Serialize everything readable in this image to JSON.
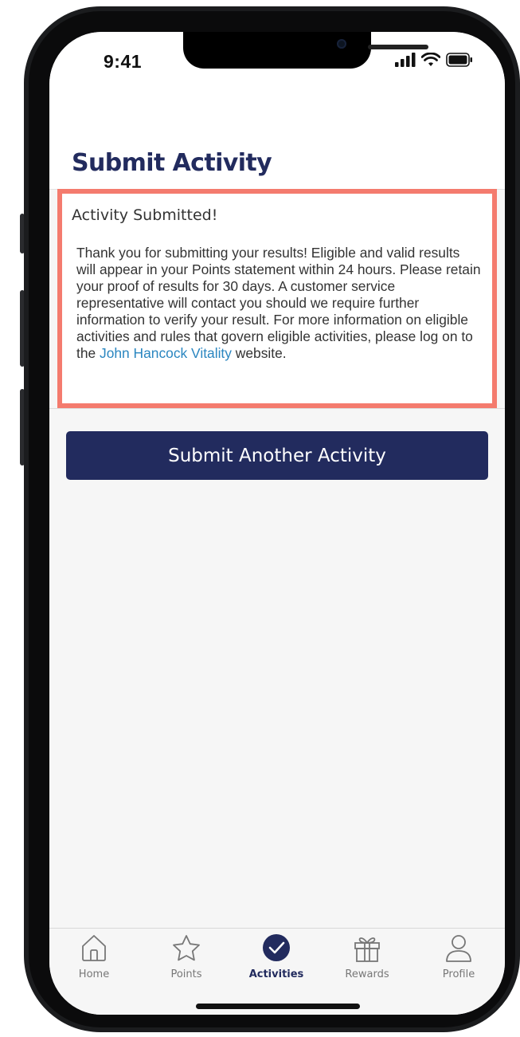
{
  "status_bar": {
    "time": "9:41"
  },
  "header": {
    "title": "Submit Activity"
  },
  "message": {
    "title": "Activity Submitted!",
    "body_before_link": "Thank you for submitting your results! Eligible and valid results will appear in your Points statement within 24 hours. Please retain your proof of results for 30 days. A customer service representative will contact you should we require further information to verify your result. For more information on eligible activities and rules that govern eligible activities, please log on to the ",
    "link_text": "John Hancock Vitality",
    "body_after_link": " website."
  },
  "actions": {
    "submit_another_label": "Submit Another Activity"
  },
  "tab_bar": {
    "active": "Activities",
    "tabs": [
      {
        "label": "Home",
        "icon": "home-icon"
      },
      {
        "label": "Points",
        "icon": "star-icon"
      },
      {
        "label": "Activities",
        "icon": "checkmark-circle-icon"
      },
      {
        "label": "Rewards",
        "icon": "gift-icon"
      },
      {
        "label": "Profile",
        "icon": "person-icon"
      }
    ]
  },
  "colors": {
    "brand_navy": "#222b5e",
    "highlight_border": "#f47b6e",
    "link": "#2a86c0"
  }
}
